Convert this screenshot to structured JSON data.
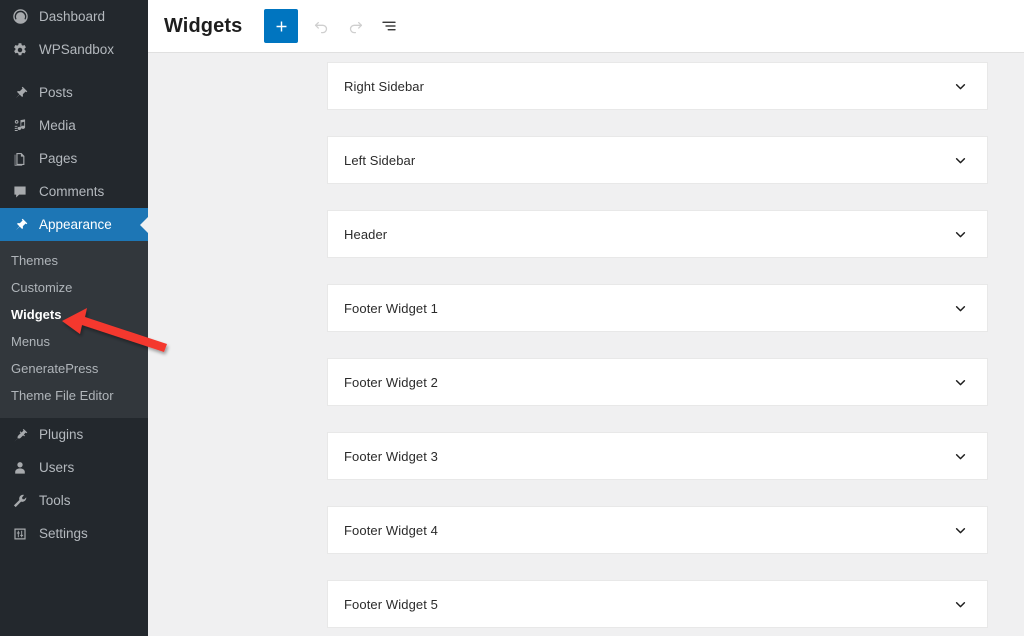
{
  "sidebar": {
    "items": [
      {
        "label": "Dashboard",
        "icon": "dashboard-icon",
        "current": false
      },
      {
        "label": "WPSandbox",
        "icon": "gear-icon",
        "current": false
      },
      {
        "label": "Posts",
        "icon": "pin-icon",
        "current": false
      },
      {
        "label": "Media",
        "icon": "media-icon",
        "current": false
      },
      {
        "label": "Pages",
        "icon": "pages-icon",
        "current": false
      },
      {
        "label": "Comments",
        "icon": "comments-icon",
        "current": false
      },
      {
        "label": "Appearance",
        "icon": "appearance-brush-icon",
        "current": true
      },
      {
        "label": "Plugins",
        "icon": "plugins-plug-icon",
        "current": false
      },
      {
        "label": "Users",
        "icon": "users-icon",
        "current": false
      },
      {
        "label": "Tools",
        "icon": "tools-wrench-icon",
        "current": false
      },
      {
        "label": "Settings",
        "icon": "settings-sliders-icon",
        "current": false
      }
    ],
    "submenu": {
      "parent": "Appearance",
      "items": [
        {
          "label": "Themes",
          "current": false
        },
        {
          "label": "Customize",
          "current": false
        },
        {
          "label": "Widgets",
          "current": true
        },
        {
          "label": "Menus",
          "current": false
        },
        {
          "label": "GeneratePress",
          "current": false
        },
        {
          "label": "Theme File Editor",
          "current": false
        }
      ]
    }
  },
  "header": {
    "title": "Widgets",
    "buttons": [
      {
        "name": "add-block-button",
        "icon": "plus-icon",
        "label": "Add block",
        "state": "enabled"
      },
      {
        "name": "undo-button",
        "icon": "undo-arrow-icon",
        "label": "Undo",
        "state": "disabled"
      },
      {
        "name": "redo-button",
        "icon": "redo-arrow-icon",
        "label": "Redo",
        "state": "disabled"
      },
      {
        "name": "list-view-button",
        "icon": "list-view-icon",
        "label": "List view",
        "state": "enabled"
      }
    ]
  },
  "main": {
    "widget_areas": [
      {
        "title": "Right Sidebar",
        "expanded": false,
        "chevron": "chevron-down-icon"
      },
      {
        "title": "Left Sidebar",
        "expanded": false,
        "chevron": "chevron-down-icon"
      },
      {
        "title": "Header",
        "expanded": false,
        "chevron": "chevron-down-icon"
      },
      {
        "title": "Footer Widget 1",
        "expanded": false,
        "chevron": "chevron-down-icon"
      },
      {
        "title": "Footer Widget 2",
        "expanded": false,
        "chevron": "chevron-down-icon"
      },
      {
        "title": "Footer Widget 3",
        "expanded": false,
        "chevron": "chevron-down-icon"
      },
      {
        "title": "Footer Widget 4",
        "expanded": false,
        "chevron": "chevron-down-icon"
      },
      {
        "title": "Footer Widget 5",
        "expanded": false,
        "chevron": "chevron-down-icon"
      }
    ]
  },
  "annotation": {
    "type": "arrow",
    "color": "#f4372f",
    "points_to": "Widgets",
    "direction": "left"
  },
  "colors": {
    "sidebar_bg": "#23282d",
    "submenu_bg": "#32373c",
    "current_menu_bg": "#1d76b5",
    "accent_blue": "#0075c0",
    "canvas_bg": "#f0f0f1",
    "panel_bg": "#ffffff",
    "annotation_red": "#f4372f"
  }
}
